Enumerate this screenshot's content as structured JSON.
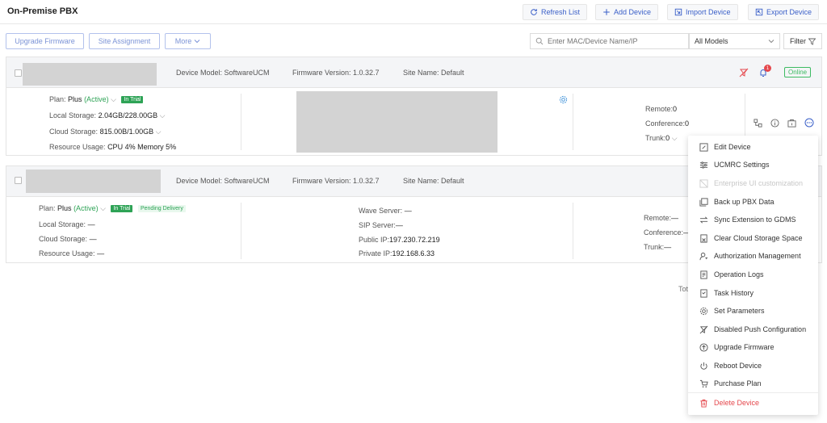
{
  "header": {
    "title": "On-Premise PBX",
    "buttons": {
      "refresh": "Refresh List",
      "add": "Add Device",
      "import": "Import Device",
      "export": "Export Device"
    }
  },
  "toolbar": {
    "upgrade_firmware": "Upgrade Firmware",
    "site_assignment": "Site Assignment",
    "more": "More",
    "search_placeholder": "Enter MAC/Device Name/IP",
    "model_select": "All Models",
    "filter": "Filter"
  },
  "devices": [
    {
      "device_model": "Device Model: SoftwareUCM",
      "firmware_version": "Firmware Version: 1.0.32.7",
      "site_name": "Site Name: Default",
      "status": "Online",
      "notification_count": "1",
      "plan_label": "Plan:",
      "plan_value": "Plus",
      "plan_state": "(Active)",
      "plan_tag": "In Trial",
      "local_storage_label": "Local Storage:",
      "local_storage_value": "2.04GB/228.00GB",
      "cloud_storage_label": "Cloud Storage:",
      "cloud_storage_value": "815.00B/1.00GB",
      "resource_label": "Resource Usage:",
      "resource_value": "CPU 4%   Memory 5%",
      "remote_label": "Remote:",
      "remote_value": "0",
      "conference_label": "Conference:",
      "conference_value": "0",
      "trunk_label": "Trunk:",
      "trunk_value": "0"
    },
    {
      "device_model": "Device Model: SoftwareUCM",
      "firmware_version": "Firmware Version: 1.0.32.7",
      "site_name": "Site Name: Default",
      "plan_label": "Plan:",
      "plan_value": "Plus",
      "plan_state": "(Active)",
      "plan_tag": "In Trial",
      "plan_tag2": "Pending Delivery",
      "local_storage_label": "Local Storage:",
      "local_storage_value": "—",
      "cloud_storage_label": "Cloud Storage:",
      "cloud_storage_value": "—",
      "resource_label": "Resource Usage:",
      "resource_value": "—",
      "wave_label": "Wave Server:",
      "wave_value": "—",
      "sip_label": "SIP Server:",
      "sip_value": "—",
      "public_ip_label": "Public IP:",
      "public_ip_value": "197.230.72.219",
      "private_ip_label": "Private IP:",
      "private_ip_value": "192.168.6.33",
      "remote_label": "Remote:",
      "remote_value": "—",
      "conference_label": "Conference:",
      "conference_value": "—",
      "trunk_label": "Trunk:",
      "trunk_value": "—"
    }
  ],
  "total_partial": "Tot",
  "context_menu": {
    "items": [
      {
        "label": "Edit Device",
        "icon": "edit-icon"
      },
      {
        "label": "UCMRC Settings",
        "icon": "sliders-icon"
      },
      {
        "label": "Enterprise UI customization",
        "icon": "customize-icon"
      },
      {
        "label": "Back up PBX Data",
        "icon": "backup-icon"
      },
      {
        "label": "Sync Extension to GDMS",
        "icon": "sync-icon"
      },
      {
        "label": "Clear Cloud Storage Space",
        "icon": "clear-storage-icon"
      },
      {
        "label": "Authorization Management",
        "icon": "user-key-icon"
      },
      {
        "label": "Operation Logs",
        "icon": "log-icon"
      },
      {
        "label": "Task History",
        "icon": "history-icon"
      },
      {
        "label": "Set Parameters",
        "icon": "gear-icon"
      },
      {
        "label": "Disabled Push Configuration",
        "icon": "push-off-icon"
      },
      {
        "label": "Upgrade Firmware",
        "icon": "upgrade-icon"
      },
      {
        "label": "Reboot Device",
        "icon": "power-icon"
      },
      {
        "label": "Purchase Plan",
        "icon": "cart-icon"
      },
      {
        "label": "Delete Device",
        "icon": "trash-icon"
      }
    ]
  },
  "colors": {
    "primary": "#3a5fc8",
    "success": "#2ea356",
    "danger": "#e5484d"
  }
}
